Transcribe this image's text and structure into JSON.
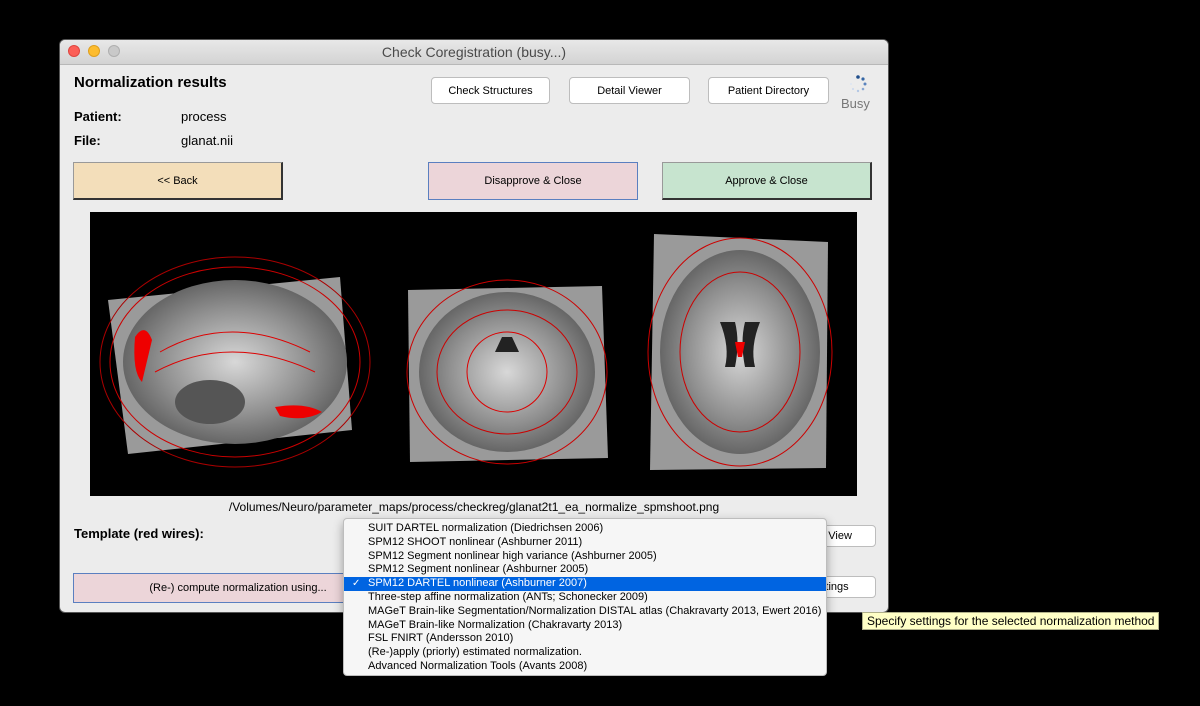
{
  "window": {
    "title": "Check Coregistration (busy...)"
  },
  "header": {
    "title": "Normalization results"
  },
  "info": {
    "patient_label": "Patient:",
    "patient_value": "process",
    "file_label": "File:",
    "file_value": "glanat.nii"
  },
  "toolbar": {
    "check_structures": "Check Structures",
    "detail_viewer": "Detail Viewer",
    "patient_directory": "Patient Directory",
    "busy": "Busy"
  },
  "actions": {
    "back": "<< Back",
    "disapprove": "Disapprove & Close",
    "approve": "Approve & Close",
    "back_color": "#f3deba",
    "disapprove_color": "#ecd5d9",
    "approve_color": "#c7e4cf"
  },
  "viewer": {
    "path": "/Volumes/Neuro/parameter_maps/process/checkreg/glanat2t1_ea_normalize_spmshoot.png"
  },
  "template": {
    "label": "Template (red wires):",
    "refresh_view_partial": "h View",
    "settings_partial": "ttings"
  },
  "compute": {
    "label": "(Re-) compute normalization using..."
  },
  "dropdown": {
    "selected_index": 4,
    "options": [
      "SUIT DARTEL normalization (Diedrichsen 2006)",
      "SPM12 SHOOT nonlinear (Ashburner 2011)",
      "SPM12 Segment nonlinear high variance (Ashburner 2005)",
      "SPM12 Segment nonlinear (Ashburner 2005)",
      "SPM12 DARTEL nonlinear (Ashburner 2007)",
      "Three-step affine normalization (ANTs; Schonecker 2009)",
      "MAGeT Brain-like Segmentation/Normalization DISTAL atlas (Chakravarty 2013, Ewert 2016)",
      "MAGeT Brain-like Normalization (Chakravarty 2013)",
      "FSL FNIRT (Andersson 2010)",
      "(Re-)apply (priorly) estimated normalization.",
      "Advanced Normalization Tools (Avants 2008)"
    ],
    "check": "✓"
  },
  "tooltip": {
    "text": "Specify settings for the selected normalization method"
  }
}
